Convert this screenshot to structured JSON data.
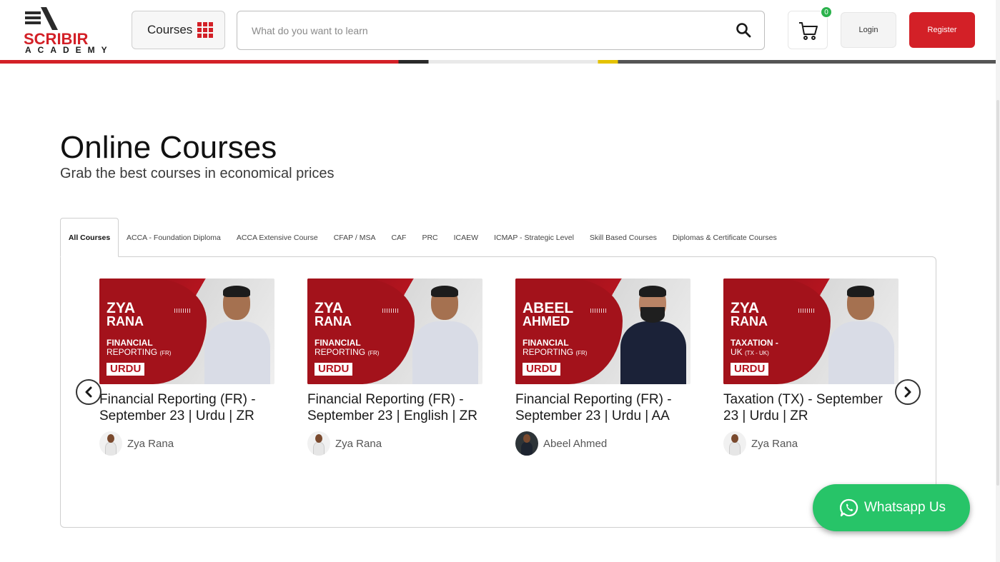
{
  "header": {
    "logo_word": "SCRIBIR",
    "logo_sub": "ACADEMY",
    "courses_label": "Courses",
    "search_placeholder": "What do you want to learn",
    "cart_count": "0",
    "login_label": "Login",
    "register_label": "Register"
  },
  "section": {
    "title": "Online Courses",
    "subtitle": "Grab the best courses in economical prices"
  },
  "tabs": [
    {
      "label": "All Courses",
      "active": true
    },
    {
      "label": "ACCA - Foundation Diploma"
    },
    {
      "label": "ACCA Extensive Course"
    },
    {
      "label": "CFAP / MSA"
    },
    {
      "label": "CAF"
    },
    {
      "label": "PRC"
    },
    {
      "label": "ICAEW"
    },
    {
      "label": "ICMAP - Strategic Level"
    },
    {
      "label": "Skill Based Courses"
    },
    {
      "label": "Diplomas & Certificate Courses"
    }
  ],
  "cards": [
    {
      "thumb_first": "ZYA",
      "thumb_last": "RANA",
      "thumb_topic": "FINANCIAL",
      "thumb_topic2": "REPORTING",
      "thumb_topic_abbr": "(FR)",
      "thumb_tag": "URDU",
      "title": "Financial Reporting (FR) - September 23 | Urdu | ZR",
      "instructor": "Zya Rana"
    },
    {
      "thumb_first": "ZYA",
      "thumb_last": "RANA",
      "thumb_topic": "FINANCIAL",
      "thumb_topic2": "REPORTING",
      "thumb_topic_abbr": "(FR)",
      "thumb_tag": "URDU",
      "title": "Financial Reporting (FR) - September 23 | English | ZR",
      "instructor": "Zya Rana"
    },
    {
      "thumb_first": "ABEEL",
      "thumb_last": "AHMED",
      "thumb_topic": "FINANCIAL",
      "thumb_topic2": "REPORTING",
      "thumb_topic_abbr": "(FR)",
      "thumb_tag": "URDU",
      "title": "Financial Reporting (FR) - September 23 | Urdu | AA",
      "instructor": "Abeel Ahmed"
    },
    {
      "thumb_first": "ZYA",
      "thumb_last": "RANA",
      "thumb_topic": "TAXATION -",
      "thumb_topic2": "UK",
      "thumb_topic_abbr": "(TX - UK)",
      "thumb_tag": "URDU",
      "title": "Taxation (TX) - September 23 | Urdu | ZR",
      "instructor": "Zya Rana"
    }
  ],
  "whatsapp_label": "Whatsapp Us",
  "colors": {
    "brand_red": "#d32027",
    "whatsapp_green": "#27c468",
    "badge_green": "#2bb24c"
  }
}
